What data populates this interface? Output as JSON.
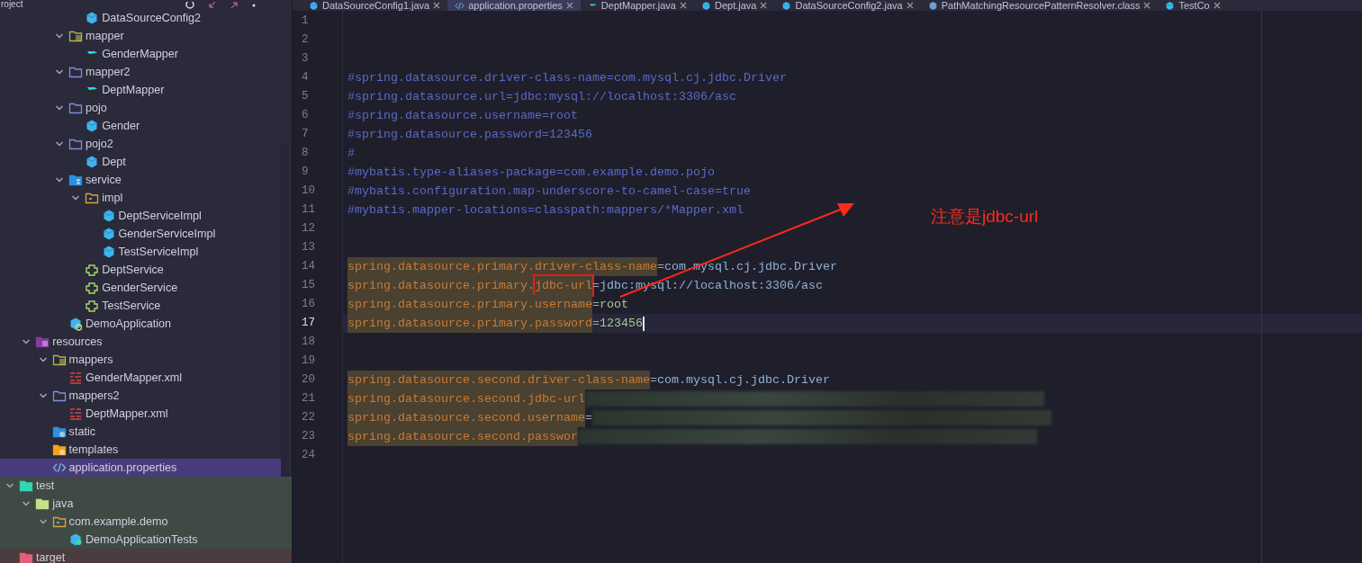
{
  "project_panel": {
    "title": "roject",
    "tree": [
      {
        "children": [
          {
            "children": [
              {
                "children": [
                  {
                    "children": [
                      {
                        "label": "DataSourceConfig2",
                        "kind": "class",
                        "selected": false
                      }
                    ]
                  },
                  {
                    "label": "mapper",
                    "kind": "mapper-folder",
                    "expanded": true,
                    "selected": false,
                    "children": [
                      {
                        "label": "GenderMapper",
                        "kind": "mapper",
                        "selected": false
                      }
                    ]
                  },
                  {
                    "label": "mapper2",
                    "kind": "folder",
                    "expanded": true,
                    "selected": false,
                    "children": [
                      {
                        "label": "DeptMapper",
                        "kind": "mapper",
                        "selected": false
                      }
                    ]
                  },
                  {
                    "label": "pojo",
                    "kind": "folder",
                    "expanded": true,
                    "selected": false,
                    "children": [
                      {
                        "label": "Gender",
                        "kind": "class",
                        "selected": false
                      }
                    ]
                  },
                  {
                    "label": "pojo2",
                    "kind": "folder",
                    "expanded": true,
                    "selected": false,
                    "children": [
                      {
                        "label": "Dept",
                        "kind": "class",
                        "selected": false
                      }
                    ]
                  },
                  {
                    "label": "service",
                    "kind": "service-folder",
                    "expanded": true,
                    "selected": false,
                    "children": [
                      {
                        "label": "impl",
                        "kind": "package",
                        "expanded": true,
                        "selected": false,
                        "children": [
                          {
                            "label": "DeptServiceImpl",
                            "kind": "class",
                            "selected": false
                          },
                          {
                            "label": "GenderServiceImpl",
                            "kind": "class",
                            "selected": false
                          },
                          {
                            "label": "TestServiceImpl",
                            "kind": "class",
                            "selected": false
                          }
                        ]
                      },
                      {
                        "label": "DeptService",
                        "kind": "interface",
                        "selected": false
                      },
                      {
                        "label": "GenderService",
                        "kind": "interface",
                        "selected": false
                      },
                      {
                        "label": "TestService",
                        "kind": "interface",
                        "selected": false
                      }
                    ]
                  },
                  {
                    "label": "DemoApplication",
                    "kind": "app",
                    "selected": false
                  }
                ]
              }
            ]
          },
          {
            "label": "resources",
            "kind": "resources",
            "expanded": true,
            "selected": false,
            "children": [
              {
                "label": "mappers",
                "kind": "mapper-folder",
                "expanded": true,
                "selected": false,
                "children": [
                  {
                    "label": "GenderMapper.xml",
                    "kind": "xml",
                    "selected": false
                  }
                ]
              },
              {
                "label": "mappers2",
                "kind": "folder",
                "expanded": true,
                "selected": false,
                "children": [
                  {
                    "label": "DeptMapper.xml",
                    "kind": "xml",
                    "selected": false
                  }
                ]
              },
              {
                "label": "static",
                "kind": "static",
                "selected": false
              },
              {
                "label": "templates",
                "kind": "templates",
                "selected": false
              },
              {
                "label": "application.properties",
                "kind": "properties",
                "selected": true
              }
            ]
          }
        ]
      },
      {
        "label": "test",
        "kind": "test-root",
        "expanded": true,
        "selected": false,
        "children": [
          {
            "label": "java",
            "kind": "test-source",
            "expanded": true,
            "selected": false,
            "children": [
              {
                "label": "com.example.demo",
                "kind": "package",
                "expanded": true,
                "selected": false,
                "children": [
                  {
                    "label": "DemoApplicationTests",
                    "kind": "test-class",
                    "selected": false
                  }
                ]
              }
            ]
          }
        ]
      },
      {
        "label": "target",
        "kind": "excluded",
        "selected": false
      }
    ]
  },
  "tabs": [
    {
      "label": "DataSourceConfig1.java",
      "kind": "class",
      "selected": false
    },
    {
      "label": "application.properties",
      "kind": "properties",
      "selected": true
    },
    {
      "label": "DeptMapper.java",
      "kind": "mapper",
      "selected": false
    },
    {
      "label": "Dept.java",
      "kind": "class",
      "selected": false
    },
    {
      "label": "DataSourceConfig2.java",
      "kind": "class",
      "selected": false
    },
    {
      "label": "PathMatchingResourcePatternResolver.class",
      "kind": "compiled",
      "selected": false
    },
    {
      "label": "TestCo",
      "kind": "class",
      "selected": false
    }
  ],
  "editor": {
    "lines": [
      {
        "number": "1",
        "kind": "blank",
        "current": false
      },
      {
        "number": "2",
        "kind": "blank",
        "current": false
      },
      {
        "number": "3",
        "kind": "blank",
        "current": false
      },
      {
        "number": "4",
        "kind": "comment",
        "text": "#spring.datasource.driver-class-name=com.mysql.cj.jdbc.Driver",
        "current": false
      },
      {
        "number": "5",
        "kind": "comment",
        "text": "#spring.datasource.url=jdbc:mysql://localhost:3306/asc",
        "current": false
      },
      {
        "number": "6",
        "kind": "comment",
        "text": "#spring.datasource.username=root",
        "current": false
      },
      {
        "number": "7",
        "kind": "comment",
        "text": "#spring.datasource.password=123456",
        "current": false
      },
      {
        "number": "8",
        "kind": "comment",
        "text": "#",
        "current": false
      },
      {
        "number": "9",
        "kind": "comment",
        "text": "#mybatis.type-aliases-package=com.example.demo.pojo",
        "current": false
      },
      {
        "number": "10",
        "kind": "comment",
        "text": "#mybatis.configuration.map-underscore-to-camel-case=true",
        "current": false
      },
      {
        "number": "11",
        "kind": "comment",
        "text": "#mybatis.mapper-locations=classpath:mappers/*Mapper.xml",
        "current": false
      },
      {
        "number": "12",
        "kind": "blank",
        "current": false
      },
      {
        "number": "13",
        "kind": "blank",
        "current": false
      },
      {
        "number": "14",
        "kind": "property",
        "key": "spring.datasource.primary.driver-class-name",
        "sep": "=",
        "value": "com.mysql.cj.jdbc.Driver",
        "current": false
      },
      {
        "number": "15",
        "kind": "property",
        "key": "spring.datasource.primary.",
        "boxed": "jdbc-url",
        "sep": "=",
        "value": "jdbc:mysql://localhost:3306/asc",
        "current": false
      },
      {
        "number": "16",
        "kind": "property",
        "key": "spring.datasource.primary.username",
        "sep": "=",
        "value": "root",
        "current": false
      },
      {
        "number": "17",
        "kind": "property",
        "key": "spring.datasource.primary.password",
        "sep": "=",
        "value": "123456",
        "current": true
      },
      {
        "number": "18",
        "kind": "blank",
        "current": false
      },
      {
        "number": "19",
        "kind": "blank",
        "current": false
      },
      {
        "number": "20",
        "kind": "property",
        "key": "spring.datasource.second.driver-class-name",
        "sep": "=",
        "value": "com.mysql.cj.jdbc.Driver",
        "current": false
      },
      {
        "number": "21",
        "kind": "redacted",
        "key": "spring.datasource.second.jdbc-url",
        "current": false
      },
      {
        "number": "22",
        "kind": "redacted",
        "key": "spring.datasource.second.username",
        "sep": "=",
        "current": false
      },
      {
        "number": "23",
        "kind": "redacted",
        "key": "spring.datasource.second.passwor",
        "current": false
      },
      {
        "number": "24",
        "kind": "blank",
        "current": false
      }
    ]
  },
  "annotation": {
    "text": "注意是jdbc-url"
  }
}
